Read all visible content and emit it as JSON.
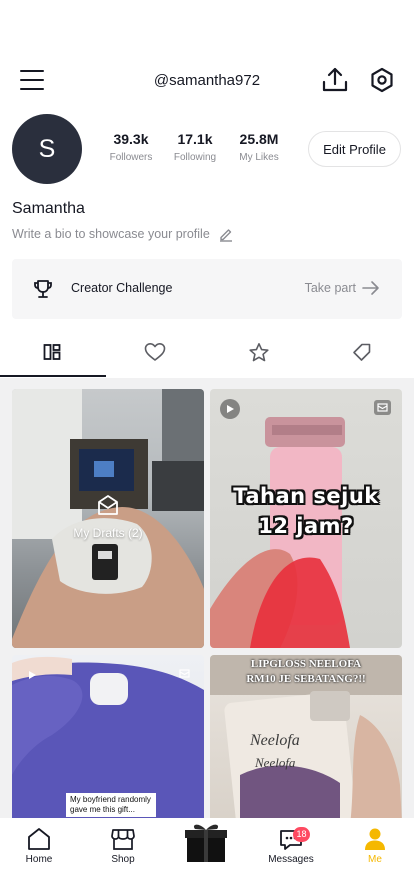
{
  "header": {
    "username": "@samantha972",
    "menu_icon": "hamburger-menu-icon",
    "upload_icon": "upload-icon",
    "settings_icon": "settings-hexagon-icon"
  },
  "profile": {
    "avatar_initial": "S",
    "display_name": "Samantha",
    "bio_placeholder": "Write a bio to showcase your profile",
    "stats": {
      "followers": {
        "value": "39.3k",
        "label": "Followers"
      },
      "following": {
        "value": "17.1k",
        "label": "Following"
      },
      "likes": {
        "value": "25.8M",
        "label": "My Likes"
      }
    },
    "edit_label": "Edit Profile"
  },
  "challenge": {
    "title": "Creator Challenge",
    "cta": "Take part"
  },
  "tabs": [
    {
      "name": "videos",
      "icon": "grid-icon",
      "active": true
    },
    {
      "name": "liked",
      "icon": "heart-icon",
      "active": false
    },
    {
      "name": "favorites",
      "icon": "star-icon",
      "active": false
    },
    {
      "name": "tagged",
      "icon": "tag-icon",
      "active": false
    }
  ],
  "grid": {
    "drafts_label": "My Drafts (2)",
    "tumbler_caption_line1": "Tahan sejuk",
    "tumbler_caption_line2": "12 jam?",
    "bag_caption": "My boyfriend randomly gave me this gift...",
    "lipgloss_caption_line1": "LIPGLOSS NEELOFA",
    "lipgloss_caption_line2": "RM10 JE SEBATANG?!!"
  },
  "nav": {
    "home": "Home",
    "shop": "Shop",
    "messages": "Messages",
    "messages_badge": "18",
    "me": "Me"
  },
  "colors": {
    "accent_yellow": "#f5b800",
    "badge_red": "#fe4a61",
    "avatar_bg": "#2a2f3d"
  }
}
